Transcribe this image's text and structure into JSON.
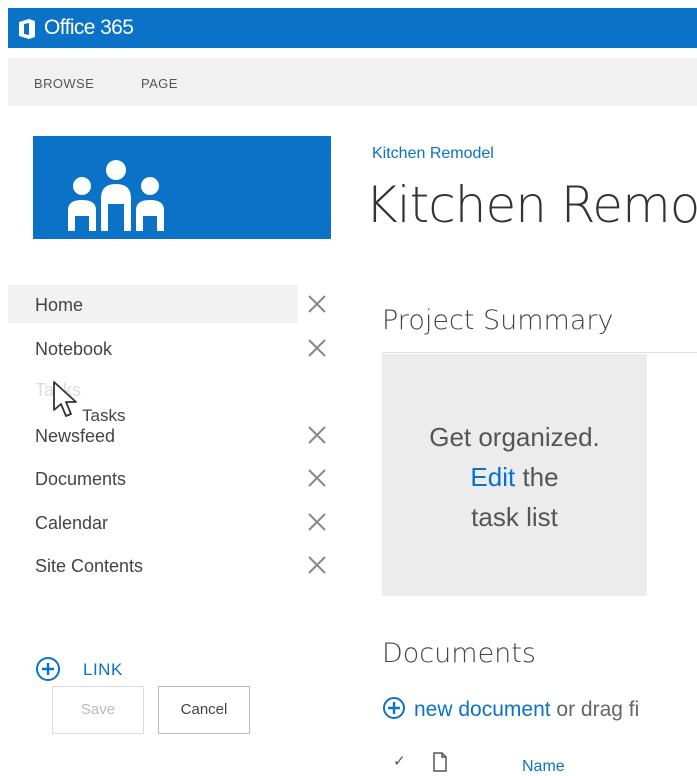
{
  "app": {
    "title": "Office 365"
  },
  "ribbon": {
    "tabs": [
      "BROWSE",
      "PAGE"
    ]
  },
  "site": {
    "breadcrumb": "Kitchen Remodel",
    "title": "Kitchen Remo"
  },
  "nav": {
    "items": [
      {
        "label": "Home"
      },
      {
        "label": "Notebook"
      },
      {
        "label": "Newsfeed"
      },
      {
        "label": "Documents"
      },
      {
        "label": "Calendar"
      },
      {
        "label": "Site Contents"
      }
    ],
    "ghost_label": "Tasks",
    "dragging_label": "Tasks",
    "link_label": "LINK",
    "save_label": "Save",
    "cancel_label": "Cancel"
  },
  "main": {
    "project_summary_title": "Project Summary",
    "summary_line1": "Get organized.",
    "summary_edit": "Edit",
    "summary_the": " the",
    "summary_line3": "task list",
    "documents_title": "Documents",
    "new_document_label": "new document",
    "drag_text": " or drag fi",
    "column_name": "Name"
  },
  "colors": {
    "accent": "#0a72c7"
  }
}
